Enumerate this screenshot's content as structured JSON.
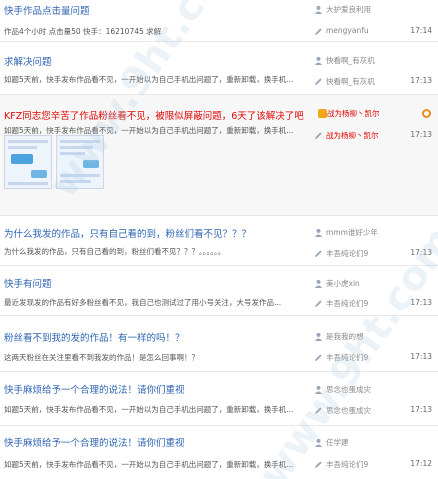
{
  "threads": [
    {
      "title": "快手作品点击量问题",
      "excerpt": "作品4个小时 点击量50 快手：16210745 求解",
      "author": "大护爱良利用",
      "last_reply": "mengyanfu",
      "time": "17:14",
      "title_color": "#2d64b3"
    },
    {
      "title": "求解决问题",
      "excerpt": "如题5天前，快手发布作品看不见，一开始以为自己手机出问题了，重新卸载，换手机...",
      "author": "快看啊_有灰机",
      "last_reply": "快看啊_有灰机",
      "time": "17:13",
      "title_color": "#2d64b3"
    },
    {
      "title": "KFZ同志您辛苦了作品粉丝看不见，被限似屏蔽问题，6天了该解决了吧",
      "excerpt": "如题5天前，快手发布作品看不见，一开始以为自己手机出问题了，重新卸载，换手机...",
      "author": "战为杨柳丶凯尔",
      "last_reply": "战为杨柳丶凯尔",
      "time": "17:13",
      "title_color": "#e10602"
    },
    {
      "title": "为什么我发的作品，只有自己看的到，粉丝们看不见？？？",
      "excerpt": "为什么我发的作品，只有自己看的到，粉丝们看不见？？？。。。。。。",
      "author": "mmm谁好少年",
      "last_reply": "丰吾纯论们9",
      "time": "17:13",
      "title_color": "#2d64b3"
    },
    {
      "title": "快手有问题",
      "excerpt": "最近发现发的作品有好多粉丝看不见，我自己也测试过了用小号关注，大号发作品...",
      "author": "美小虎xin",
      "last_reply": "丰吾纯论们9",
      "time": "17:13",
      "title_color": "#2d64b3"
    },
    {
      "title": "粉丝看不到我的发的作品！有一样的吗！？",
      "excerpt": "这两天粉丝在关注里看不到我发的作品！是怎么回事啊！？",
      "author": "是我我的想",
      "last_reply": "丰吾纯论们9",
      "time": "17:13",
      "title_color": "#2d64b3"
    },
    {
      "title": "快手麻烦给予一个合理的说法！请你们重视",
      "excerpt": "如题5天前，快手发布作品看不见，一开始以为自己手机出问题了，重新卸载，换手机...",
      "author": "思念也蛋成灾",
      "last_reply": "思念也蛋成灾",
      "time": "17:13",
      "title_color": "#2d64b3"
    },
    {
      "title": "快手麻烦给予一个合理的说法！请你们重视",
      "excerpt": "如题5天前，快手发布作品看不见，一开始以为自己手机出问题了，重新卸载，换手机...",
      "author": "任学建",
      "last_reply": "丰吾纯论们9",
      "time": "17:12",
      "title_color": "#2d64b3"
    }
  ],
  "watermark_text": "www.9ht.com",
  "colors": {
    "link_blue": "#2d64b3",
    "alert_red": "#e10602",
    "badge_orange": "#f4a51c"
  }
}
